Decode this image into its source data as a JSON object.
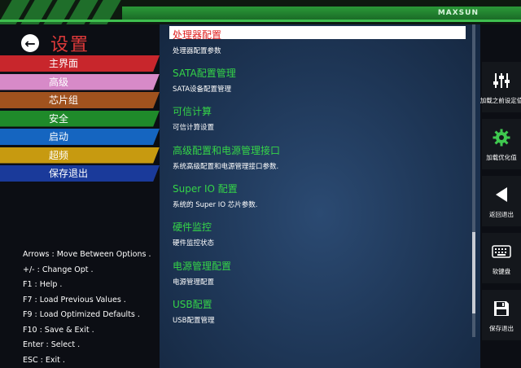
{
  "brand": "MAXSUN",
  "page_title": "设置",
  "menu": [
    {
      "label": "主界面",
      "color": "#c8262c"
    },
    {
      "label": "高级",
      "color": "#d78ac8"
    },
    {
      "label": "芯片组",
      "color": "#a0521e"
    },
    {
      "label": "安全",
      "color": "#1f8a2a"
    },
    {
      "label": "启动",
      "color": "#1565c0"
    },
    {
      "label": "超频",
      "color": "#c79a10"
    },
    {
      "label": "保存退出",
      "color": "#1a3a9a"
    }
  ],
  "help": [
    "Arrows : Move Between Options .",
    "+/- : Change Opt .",
    "F1 : Help .",
    "F7 : Load Previous Values .",
    "F9 : Load Optimized Defaults .",
    "F10 : Save & Exit .",
    "Enter : Select .",
    "ESC : Exit ."
  ],
  "entries": [
    {
      "title": "处理器配置",
      "desc": "处理器配置参数"
    },
    {
      "title": "SATA配置管理",
      "desc": "SATA设备配置管理"
    },
    {
      "title": "可信计算",
      "desc": "可信计算设置"
    },
    {
      "title": "高级配置和电源管理接口",
      "desc": "系统高级配置和电源管理接口参数."
    },
    {
      "title": "Super IO 配置",
      "desc": "系统的 Super IO 芯片参数."
    },
    {
      "title": "硬件监控",
      "desc": "硬件监控状态"
    },
    {
      "title": "电源管理配置",
      "desc": "电源管理配置"
    },
    {
      "title": "USB配置",
      "desc": "USB配置管理"
    }
  ],
  "right_buttons": [
    {
      "label": "加载之前设定值",
      "icon": "sliders-icon"
    },
    {
      "label": "加载优化值",
      "icon": "gear-icon"
    },
    {
      "label": "返回退出",
      "icon": "back-triangle-icon"
    },
    {
      "label": "软键盘",
      "icon": "keyboard-icon"
    },
    {
      "label": "保存退出",
      "icon": "floppy-icon"
    }
  ]
}
